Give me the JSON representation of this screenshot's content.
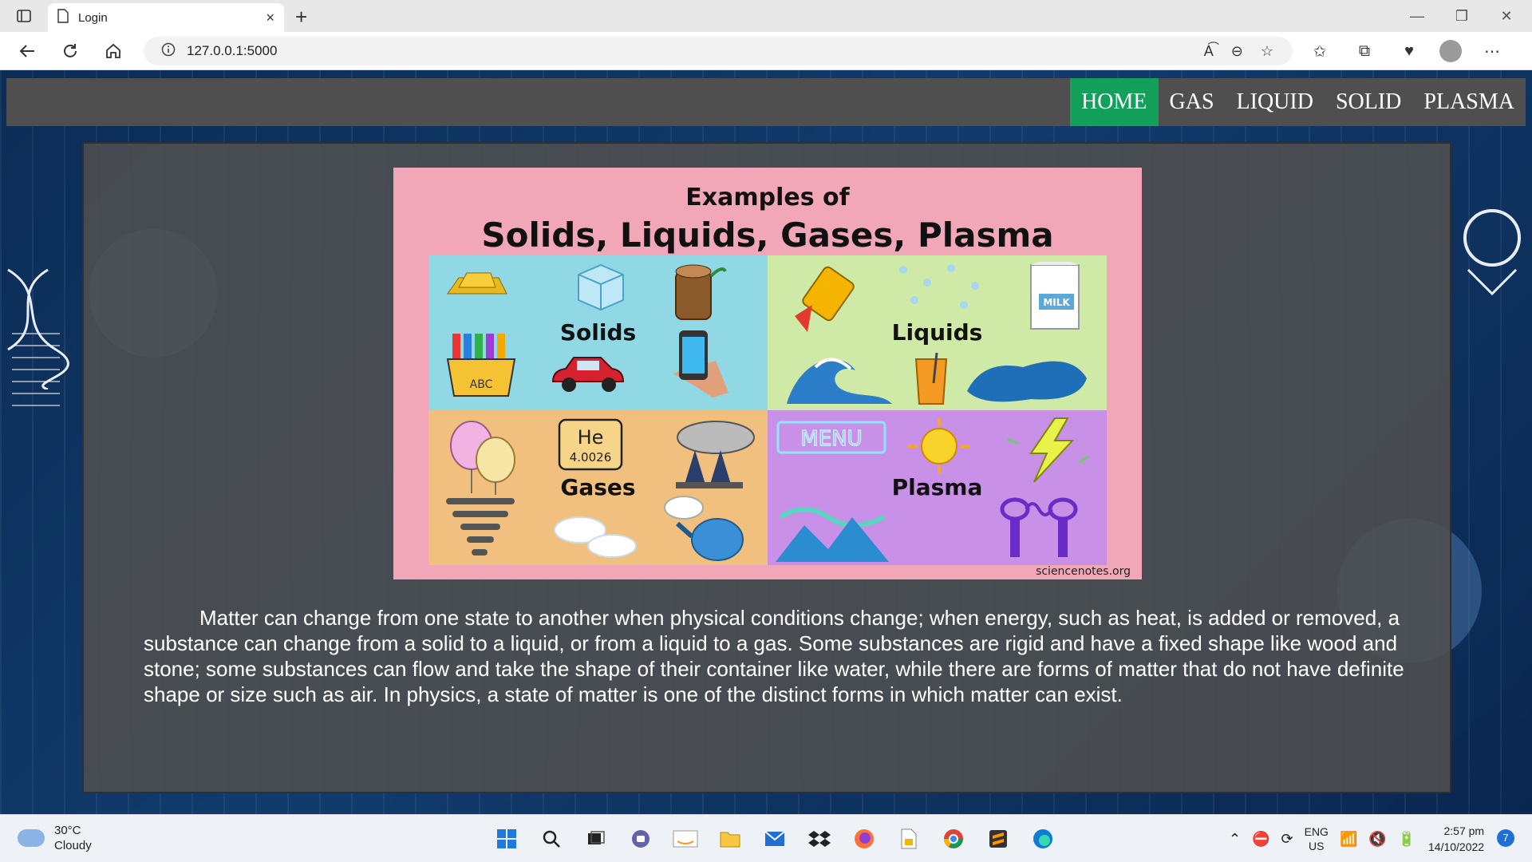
{
  "browser": {
    "tab_title": "Login",
    "url": "127.0.0.1:5000",
    "new_tab_symbol": "+",
    "close_tab_symbol": "×"
  },
  "nav": {
    "items": [
      {
        "label": "HOME",
        "active": true
      },
      {
        "label": "GAS",
        "active": false
      },
      {
        "label": "LIQUID",
        "active": false
      },
      {
        "label": "SOLID",
        "active": false
      },
      {
        "label": "PLASMA",
        "active": false
      }
    ],
    "active_color": "#12a05a"
  },
  "figure": {
    "heading_small": "Examples of",
    "heading_large": "Solids, Liquids, Gases, Plasma",
    "quadrants": {
      "solids": "Solids",
      "liquids": "Liquids",
      "gases": "Gases",
      "plasma": "Plasma"
    },
    "he_symbol": "He",
    "he_mass": "4.0026",
    "milk_label": "MILK",
    "menu_label": "MENU",
    "abc_label": "ABC",
    "credit": "sciencenotes.org"
  },
  "paragraph": "Matter can change from one state to another when physical conditions change; when energy, such as heat, is added or removed, a substance can change from a solid to a liquid, or from a liquid to a gas. Some substances are rigid and have a fixed shape like wood and stone; some substances can flow and take the shape of their container like water, while there are forms of matter that do not have definite shape or size such as air. In physics, a state of matter is one of the distinct forms in which matter can exist.",
  "taskbar": {
    "temperature": "30°C",
    "condition": "Cloudy",
    "lang_top": "ENG",
    "lang_bottom": "US",
    "time": "2:57 pm",
    "date": "14/10/2022",
    "notification_count": "7"
  }
}
